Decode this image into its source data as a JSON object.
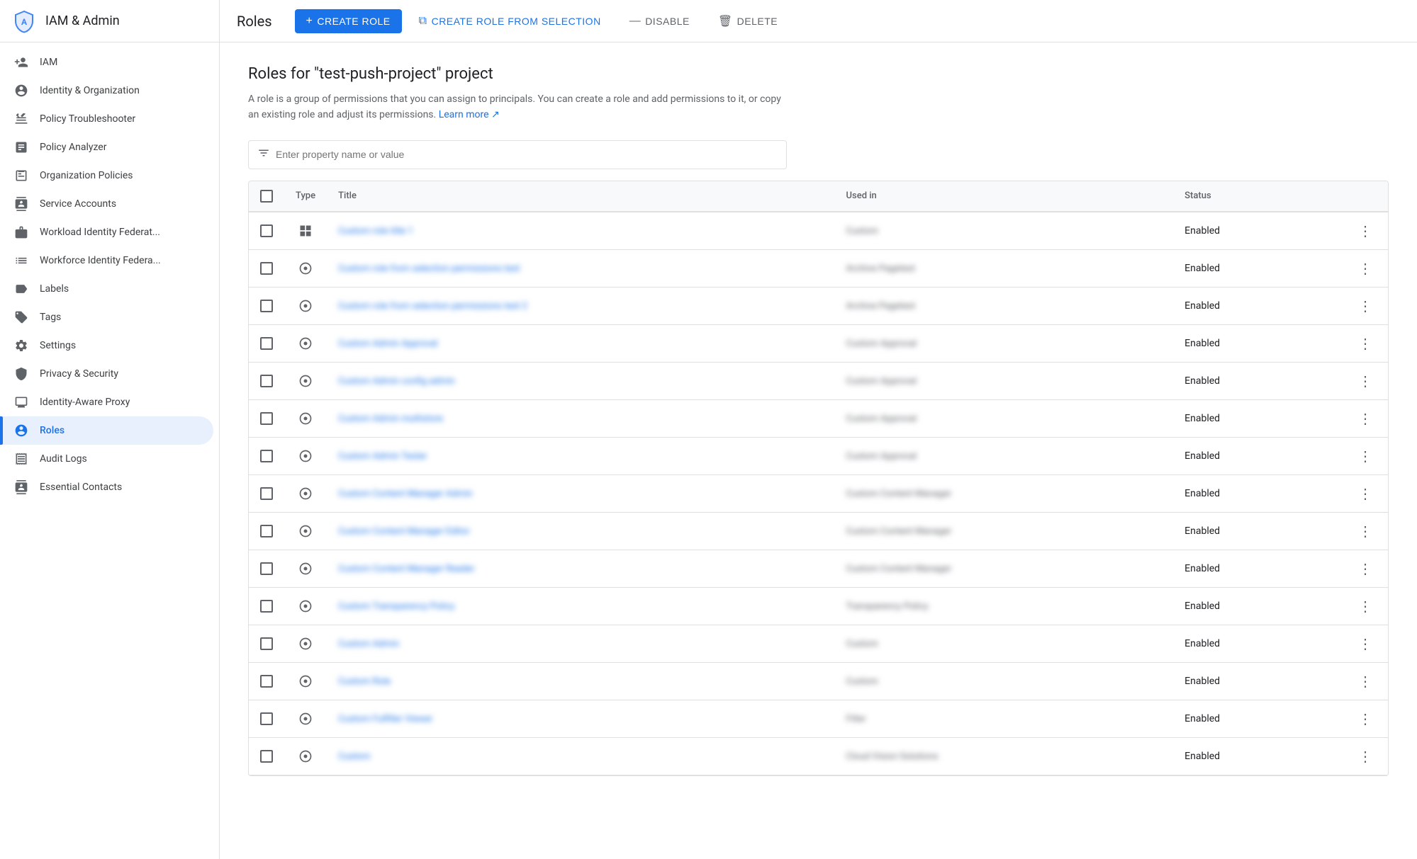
{
  "brand": {
    "title": "IAM & Admin"
  },
  "header": {
    "page_title": "Roles",
    "create_role_label": "CREATE ROLE",
    "create_role_from_selection_label": "CREATE ROLE FROM SELECTION",
    "disable_label": "DISABLE",
    "delete_label": "DELETE"
  },
  "sidebar": {
    "items": [
      {
        "id": "iam",
        "label": "IAM",
        "icon": "person-add"
      },
      {
        "id": "identity-org",
        "label": "Identity & Organization",
        "icon": "account-circle"
      },
      {
        "id": "policy-troubleshooter",
        "label": "Policy Troubleshooter",
        "icon": "wrench"
      },
      {
        "id": "policy-analyzer",
        "label": "Policy Analyzer",
        "icon": "document"
      },
      {
        "id": "organization-policies",
        "label": "Organization Policies",
        "icon": "list-alt"
      },
      {
        "id": "service-accounts",
        "label": "Service Accounts",
        "icon": "contacts"
      },
      {
        "id": "workload-identity-fed",
        "label": "Workload Identity Federat...",
        "icon": "badge"
      },
      {
        "id": "workforce-identity-fed",
        "label": "Workforce Identity Federa...",
        "icon": "list-alt-2"
      },
      {
        "id": "labels",
        "label": "Labels",
        "icon": "label"
      },
      {
        "id": "tags",
        "label": "Tags",
        "icon": "tag"
      },
      {
        "id": "settings",
        "label": "Settings",
        "icon": "settings"
      },
      {
        "id": "privacy-security",
        "label": "Privacy & Security",
        "icon": "shield"
      },
      {
        "id": "identity-aware-proxy",
        "label": "Identity-Aware Proxy",
        "icon": "monitor"
      },
      {
        "id": "roles",
        "label": "Roles",
        "icon": "person-role",
        "active": true
      },
      {
        "id": "audit-logs",
        "label": "Audit Logs",
        "icon": "receipt"
      },
      {
        "id": "essential-contacts",
        "label": "Essential Contacts",
        "icon": "contact-card"
      }
    ]
  },
  "content": {
    "title": "Roles for \"test-push-project\" project",
    "description": "A role is a group of permissions that you can assign to principals. You can create a role and add permissions to it, or copy an existing role and adjust its permissions.",
    "learn_more_label": "Learn more",
    "filter_placeholder": "Enter property name or value"
  },
  "table": {
    "columns": [
      "",
      "Type",
      "Title",
      "Used in",
      "Status",
      ""
    ],
    "rows": [
      {
        "type": "grid",
        "title": "Custom role title 1",
        "used_in": "Custom",
        "status": "Enabled"
      },
      {
        "type": "circle",
        "title": "Custom role from selection permissions test",
        "used_in": "Archive Pagetest",
        "status": "Enabled"
      },
      {
        "type": "circle",
        "title": "Custom role from selection permissions test 2",
        "used_in": "Archive Pagetest",
        "status": "Enabled"
      },
      {
        "type": "circle",
        "title": "Custom Admin Approval",
        "used_in": "Custom Approval",
        "status": "Enabled"
      },
      {
        "type": "circle",
        "title": "Custom Admin config admin",
        "used_in": "Custom Approval",
        "status": "Enabled"
      },
      {
        "type": "circle",
        "title": "Custom Admin multistore",
        "used_in": "Custom Approval",
        "status": "Enabled"
      },
      {
        "type": "circle",
        "title": "Custom Admin Tester",
        "used_in": "Custom Approval",
        "status": "Enabled"
      },
      {
        "type": "circle",
        "title": "Custom Content Manager Admin",
        "used_in": "Custom Content Manager",
        "status": "Enabled"
      },
      {
        "type": "circle",
        "title": "Custom Content Manager Editor",
        "used_in": "Custom Content Manager",
        "status": "Enabled"
      },
      {
        "type": "circle",
        "title": "Custom Content Manager Reader",
        "used_in": "Custom Content Manager",
        "status": "Enabled"
      },
      {
        "type": "circle",
        "title": "Custom Transparency Policy",
        "used_in": "Transparency Policy",
        "status": "Enabled"
      },
      {
        "type": "circle",
        "title": "Custom Admin",
        "used_in": "Custom",
        "status": "Enabled"
      },
      {
        "type": "circle",
        "title": "Custom Role",
        "used_in": "Custom",
        "status": "Enabled"
      },
      {
        "type": "circle",
        "title": "Custom Fulfiller Viewer",
        "used_in": "Filler",
        "status": "Enabled"
      },
      {
        "type": "circle",
        "title": "Custom",
        "used_in": "Cloud Vision Solutions",
        "status": "Enabled"
      }
    ]
  }
}
